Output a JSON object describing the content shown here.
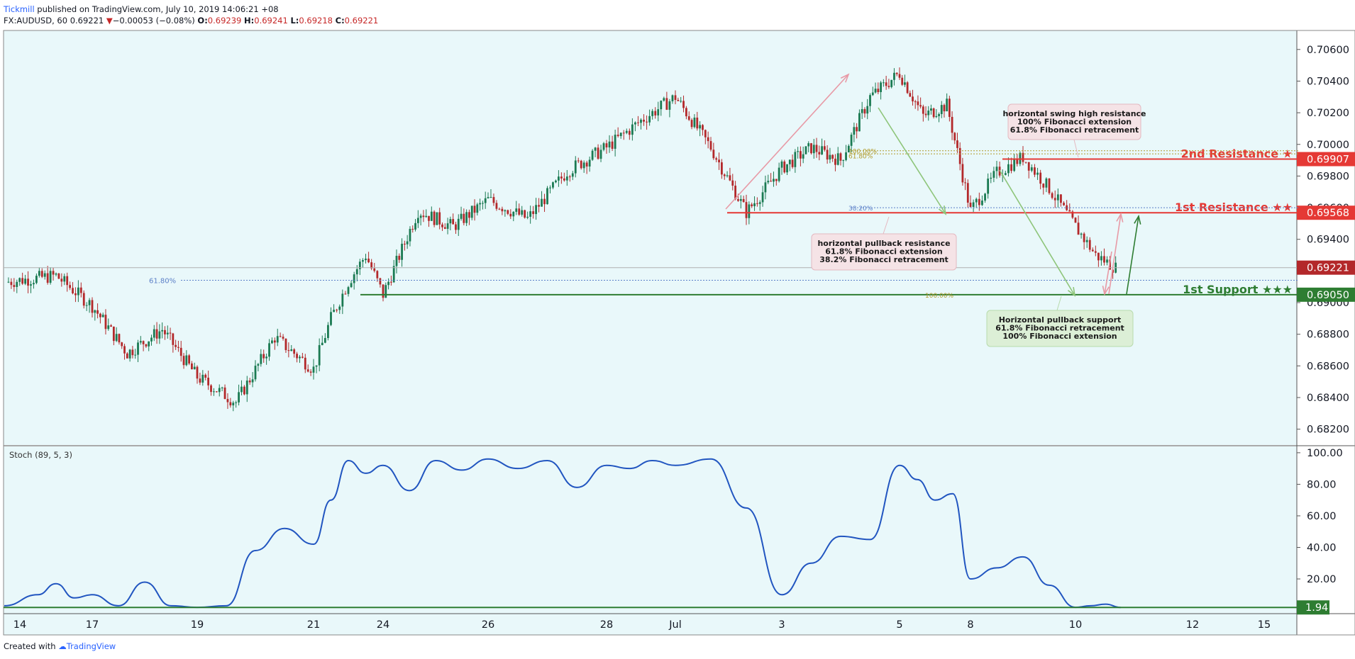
{
  "header": {
    "author": "Tickmill",
    "published": "published on TradingView.com, July 10, 2019 14:06:21 +08",
    "symbol": "FX:AUDUSD, 60",
    "last": "0.69221",
    "arrow": "▼",
    "change": "−0.00053 (−0.08%)",
    "o_label": "O:",
    "o": "0.69239",
    "h_label": "H:",
    "h": "0.69241",
    "l_label": "L:",
    "l": "0.69218",
    "c_label": "C:",
    "c": "0.69221"
  },
  "footer": {
    "created": "Created with",
    "brand": "TradingView"
  },
  "colors": {
    "background": "#e9f8fa",
    "candle_up": "#1a7a52",
    "candle_down": "#b3282a",
    "resistance": "#e53935",
    "support": "#2e7d32",
    "stoch_line": "#2155c0",
    "fib_blue": "#5b7fc7",
    "fib_gold": "#b09a2a"
  },
  "chart_data": [
    {
      "type": "candlestick",
      "title": "",
      "ylim": [
        0.681,
        0.7072
      ],
      "y_ticks": [
        "0.70600",
        "0.70400",
        "0.70200",
        "0.70000",
        "0.69800",
        "0.69600",
        "0.69400",
        "0.69200",
        "0.69000",
        "0.68800",
        "0.68600",
        "0.68400",
        "0.68200"
      ],
      "x_ticks": [
        "14",
        "17",
        "19",
        "21",
        "24",
        "26",
        "28",
        "Jul",
        "3",
        "5",
        "8",
        "10",
        "12",
        "15"
      ],
      "price_path": [
        [
          "14",
          0.6913
        ],
        [
          "14",
          0.6917
        ],
        [
          "17",
          0.6898
        ],
        [
          "17",
          0.6868
        ],
        [
          "17",
          0.6883
        ],
        [
          "19",
          0.6853
        ],
        [
          "19",
          0.6837
        ],
        [
          "19",
          0.6878
        ],
        [
          "21",
          0.6858
        ],
        [
          "21",
          0.689
        ],
        [
          "21",
          0.6913
        ],
        [
          "21",
          0.693
        ],
        [
          "24",
          0.6905
        ],
        [
          "24",
          0.6958
        ],
        [
          "24",
          0.6948
        ],
        [
          "26",
          0.6965
        ],
        [
          "26",
          0.6953
        ],
        [
          "26",
          0.6983
        ],
        [
          "28",
          0.6998
        ],
        [
          "28",
          0.7015
        ],
        [
          "Jul",
          0.703
        ],
        [
          "Jul",
          0.6998
        ],
        [
          "Jul",
          0.6957
        ],
        [
          "3",
          0.6985
        ],
        [
          "3",
          0.6998
        ],
        [
          "3",
          0.699
        ],
        [
          "3",
          0.703
        ],
        [
          "5",
          0.7045
        ],
        [
          "5",
          0.7018
        ],
        [
          "5",
          0.7025
        ],
        [
          "8",
          0.6958
        ],
        [
          "8",
          0.6982
        ],
        [
          "8",
          0.6992
        ],
        [
          "8",
          0.6972
        ],
        [
          "10",
          0.6948
        ],
        [
          "10",
          0.693
        ],
        [
          "10",
          0.6922
        ]
      ],
      "last_price": "0.69221",
      "levels": [
        {
          "label": "2nd Resistance ★",
          "value": "0.69907"
        },
        {
          "label": "1st Resistance ★★",
          "value": "0.69568"
        },
        {
          "label": "1st Support ★★★",
          "value": "0.69050"
        }
      ],
      "fib_labels": {
        "left_618": "61.80%",
        "fib_618": "61.80%",
        "fib_100_top": "100.00%",
        "fib_382": "38.20%",
        "fib_100_bottom": "100.00%"
      },
      "annotations": [
        {
          "lines": [
            "horizontal swing high resistance",
            "100% Fibonacci extension",
            "61.8% Fibonacci retracement"
          ]
        },
        {
          "lines": [
            "horizontal pullback resistance",
            "61.8% Fibonacci extension",
            "38.2% Fibonacci retracement"
          ]
        },
        {
          "lines": [
            "Horizontal pullback support",
            "61.8% Fibonacci  retracement",
            "100% Fibonacci extension"
          ]
        }
      ]
    },
    {
      "type": "line",
      "title": "Stoch (89, 5, 3)",
      "ylim": [
        -2,
        104
      ],
      "y_ticks": [
        "100.00",
        "80.00",
        "60.00",
        "40.00",
        "20.00"
      ],
      "last_value": "1.94",
      "values": [
        [
          "14",
          3
        ],
        [
          "14",
          10
        ],
        [
          "14",
          17
        ],
        [
          "14",
          8
        ],
        [
          "17",
          10
        ],
        [
          "17",
          3
        ],
        [
          "17",
          18
        ],
        [
          "17",
          3
        ],
        [
          "19",
          2
        ],
        [
          "19",
          3
        ],
        [
          "19",
          38
        ],
        [
          "19",
          52
        ],
        [
          "21",
          42
        ],
        [
          "21",
          70
        ],
        [
          "21",
          95
        ],
        [
          "21",
          87
        ],
        [
          "24",
          92
        ],
        [
          "24",
          76
        ],
        [
          "24",
          95
        ],
        [
          "24",
          89
        ],
        [
          "26",
          96
        ],
        [
          "26",
          90
        ],
        [
          "26",
          95
        ],
        [
          "26",
          78
        ],
        [
          "28",
          92
        ],
        [
          "28",
          90
        ],
        [
          "28",
          95
        ],
        [
          "Jul",
          92
        ],
        [
          "Jul",
          96
        ],
        [
          "Jul",
          65
        ],
        [
          "3",
          10
        ],
        [
          "3",
          30
        ],
        [
          "3",
          47
        ],
        [
          "3",
          45
        ],
        [
          "5",
          92
        ],
        [
          "5",
          83
        ],
        [
          "5",
          70
        ],
        [
          "5",
          74
        ],
        [
          "8",
          20
        ],
        [
          "8",
          27
        ],
        [
          "8",
          34
        ],
        [
          "8",
          16
        ],
        [
          "10",
          2
        ],
        [
          "10",
          3
        ],
        [
          "10",
          4
        ],
        [
          "10",
          1.94
        ]
      ]
    }
  ]
}
